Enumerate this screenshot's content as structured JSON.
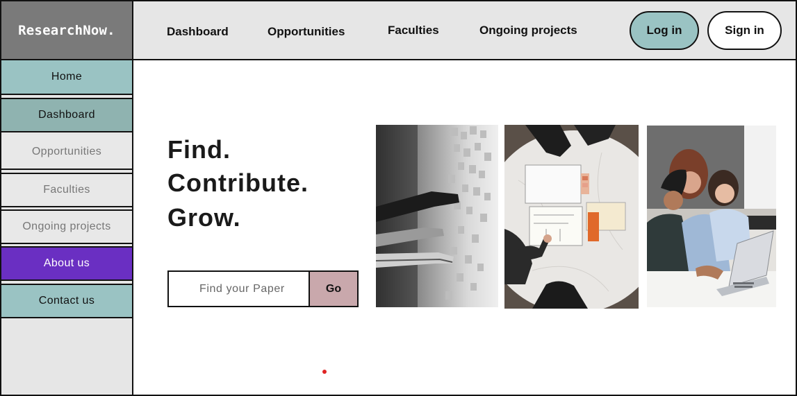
{
  "brand": {
    "logo_text": "ResearchNow."
  },
  "topnav": {
    "links": [
      "Dashboard",
      "Opportunities",
      "Faculties",
      "Ongoing projects"
    ],
    "login_label": "Log in",
    "signin_label": "Sign in"
  },
  "sidebar": {
    "items": [
      {
        "label": "Home",
        "state": "highlight"
      },
      {
        "label": "Dashboard",
        "state": "active"
      },
      {
        "label": "Opportunities",
        "state": "muted"
      },
      {
        "label": "Faculties",
        "state": "muted"
      },
      {
        "label": "Ongoing projects",
        "state": "muted"
      },
      {
        "label": "About us",
        "state": "accent"
      },
      {
        "label": "Contact us",
        "state": "highlight"
      }
    ]
  },
  "hero": {
    "lines": [
      "Find.",
      "Contribute.",
      "Grow."
    ],
    "search_placeholder": "Find your Paper",
    "go_label": "Go"
  },
  "gallery": {
    "images": [
      "sticky-notes-wall-photo",
      "table-sketching-photo",
      "team-laptop-photo"
    ]
  },
  "colors": {
    "logo_bg": "#7a7a7a",
    "topbar_bg": "#e6e6e6",
    "teal": "#9ac3c3",
    "teal_dark": "#8fb3b0",
    "muted_bg": "#e8e8e8",
    "purple": "#6a2fc2",
    "go_button": "#c9a8ac",
    "indicator_dot": "#e02424"
  }
}
